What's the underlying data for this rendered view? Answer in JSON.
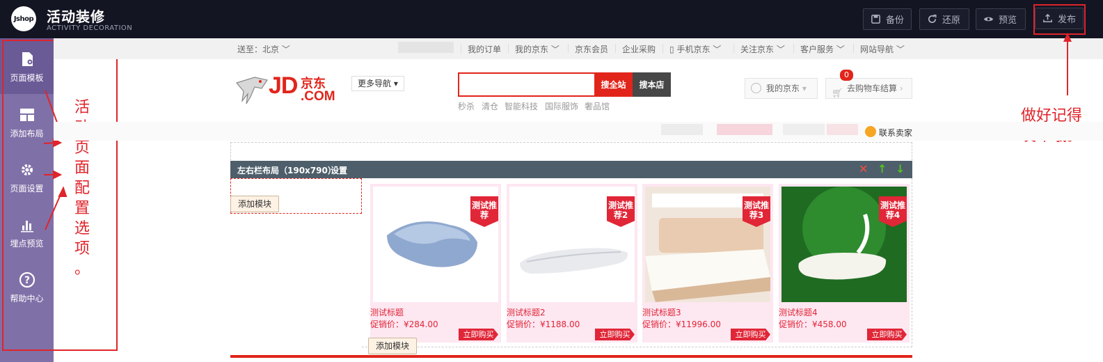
{
  "app": {
    "logo_text": "Jshop",
    "title": "活动装修",
    "subtitle": "ACTIVITY DECORATION"
  },
  "toolbar": {
    "backup": "备份",
    "restore": "还原",
    "preview": "预览",
    "publish": "发布"
  },
  "sidebar": {
    "items": [
      {
        "label": "页面模板",
        "icon": "page-template-icon"
      },
      {
        "label": "添加布局",
        "icon": "layout-icon"
      },
      {
        "label": "页面设置",
        "icon": "gear-icon"
      },
      {
        "label": "埋点预览",
        "icon": "bar-chart-icon"
      },
      {
        "label": "帮助中心",
        "icon": "help-icon"
      }
    ]
  },
  "annotations": {
    "left_note": [
      "活",
      "动",
      "页",
      "面",
      "配",
      "置",
      "选",
      "项",
      "。"
    ],
    "right_note_line1": "做好记得",
    "right_note_line2": "发布哦。"
  },
  "shortcut": {
    "ship_to": "送至：北京",
    "links": [
      "我的订单",
      "我的京东",
      "京东会员",
      "企业采购",
      "手机京东",
      "关注京东",
      "客户服务",
      "网站导航"
    ]
  },
  "header": {
    "logo_jd": "JD",
    "logo_cn": "京东",
    "logo_com": ".COM",
    "more_nav": "更多导航",
    "search_placeholder": "",
    "search_all": "搜全站",
    "search_shop": "搜本店",
    "hot_words": [
      "秒杀",
      "清仓",
      "智能科技",
      "国际服饰",
      "奢品馆"
    ],
    "my_jd": "我的京东",
    "cart": "去购物车结算",
    "cart_count": "0",
    "contact_seller": "联系卖家"
  },
  "layout": {
    "title": "左右栏布局（190x790）",
    "settings": "设置",
    "add_module": "添加模块"
  },
  "products": [
    {
      "tag": "测试推荐",
      "title": "测试标题",
      "price": "促销价：¥284.00",
      "buy": "立即购买"
    },
    {
      "tag": "测试推荐2",
      "title": "测试标题2",
      "price": "促销价：¥1188.00",
      "buy": "立即购买"
    },
    {
      "tag": "测试推荐3",
      "title": "测试标题3",
      "price": "促销价：¥11996.00",
      "buy": "立即购买"
    },
    {
      "tag": "测试推荐4",
      "title": "测试标题4",
      "price": "促销价：¥458.00",
      "buy": "立即购买"
    }
  ],
  "colors": {
    "topbar": "#131522",
    "sidebar": "#8070a8",
    "jd_red": "#e1251b",
    "annotation_red": "#e0242b"
  }
}
